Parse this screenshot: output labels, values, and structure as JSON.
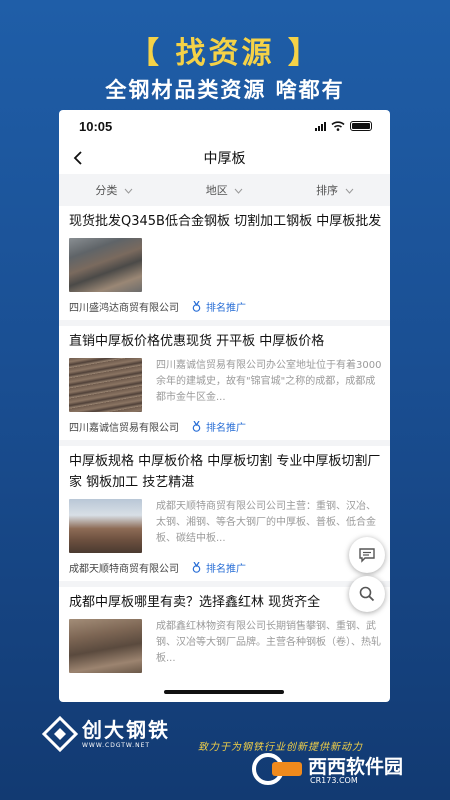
{
  "banner": {
    "headline": "【 找资源 】",
    "subline": "全钢材品类资源 啥都有"
  },
  "status_bar": {
    "time": "10:05"
  },
  "nav": {
    "title": "中厚板"
  },
  "filters": [
    {
      "label": "分类"
    },
    {
      "label": "地区"
    },
    {
      "label": "排序"
    }
  ],
  "listings": [
    {
      "title": "现货批发Q345B低合金钢板 切割加工钢板 中厚板批发",
      "description": "",
      "company": "四川盛鸿达商贸有限公司",
      "badge": "排名推广"
    },
    {
      "title": "直销中厚板价格优惠现货 开平板 中厚板价格",
      "description": "四川嘉诚信贸易有限公司办公室地址位于有着3000余年的建城史，故有\"锦官城\"之称的成都，成都成都市金牛区金...",
      "company": "四川嘉诚信贸易有限公司",
      "badge": "排名推广"
    },
    {
      "title": "中厚板规格 中厚板价格 中厚板切割 专业中厚板切割厂家 钢板加工 技艺精湛",
      "description": "成都天顺特商贸有限公司公司主营：重钢、汉冶、太钢、湘钢、等各大钢厂的中厚板、普板、低合金板、碳结中板...",
      "company": "成都天顺特商贸有限公司",
      "badge": "排名推广"
    },
    {
      "title": "成都中厚板哪里有卖？选择鑫红林 现货齐全",
      "description": "成都鑫红林物资有限公司长期销售攀钢、重钢、武钢、汉冶等大钢厂品牌。主营各种钢板（卷）、热轧板...",
      "company": "",
      "badge": ""
    }
  ],
  "footer": {
    "brand_name": "创大钢铁",
    "brand_url": "WWW.CDGTW.NET",
    "slogan": "致力于为钢铁行业创新提供新动力"
  },
  "watermark": {
    "name": "西西软件园",
    "url": "CR173.COM"
  },
  "colors": {
    "background": "#1a4f93",
    "accent_yellow": "#f5d247",
    "promo_blue": "#2a6fd6"
  }
}
